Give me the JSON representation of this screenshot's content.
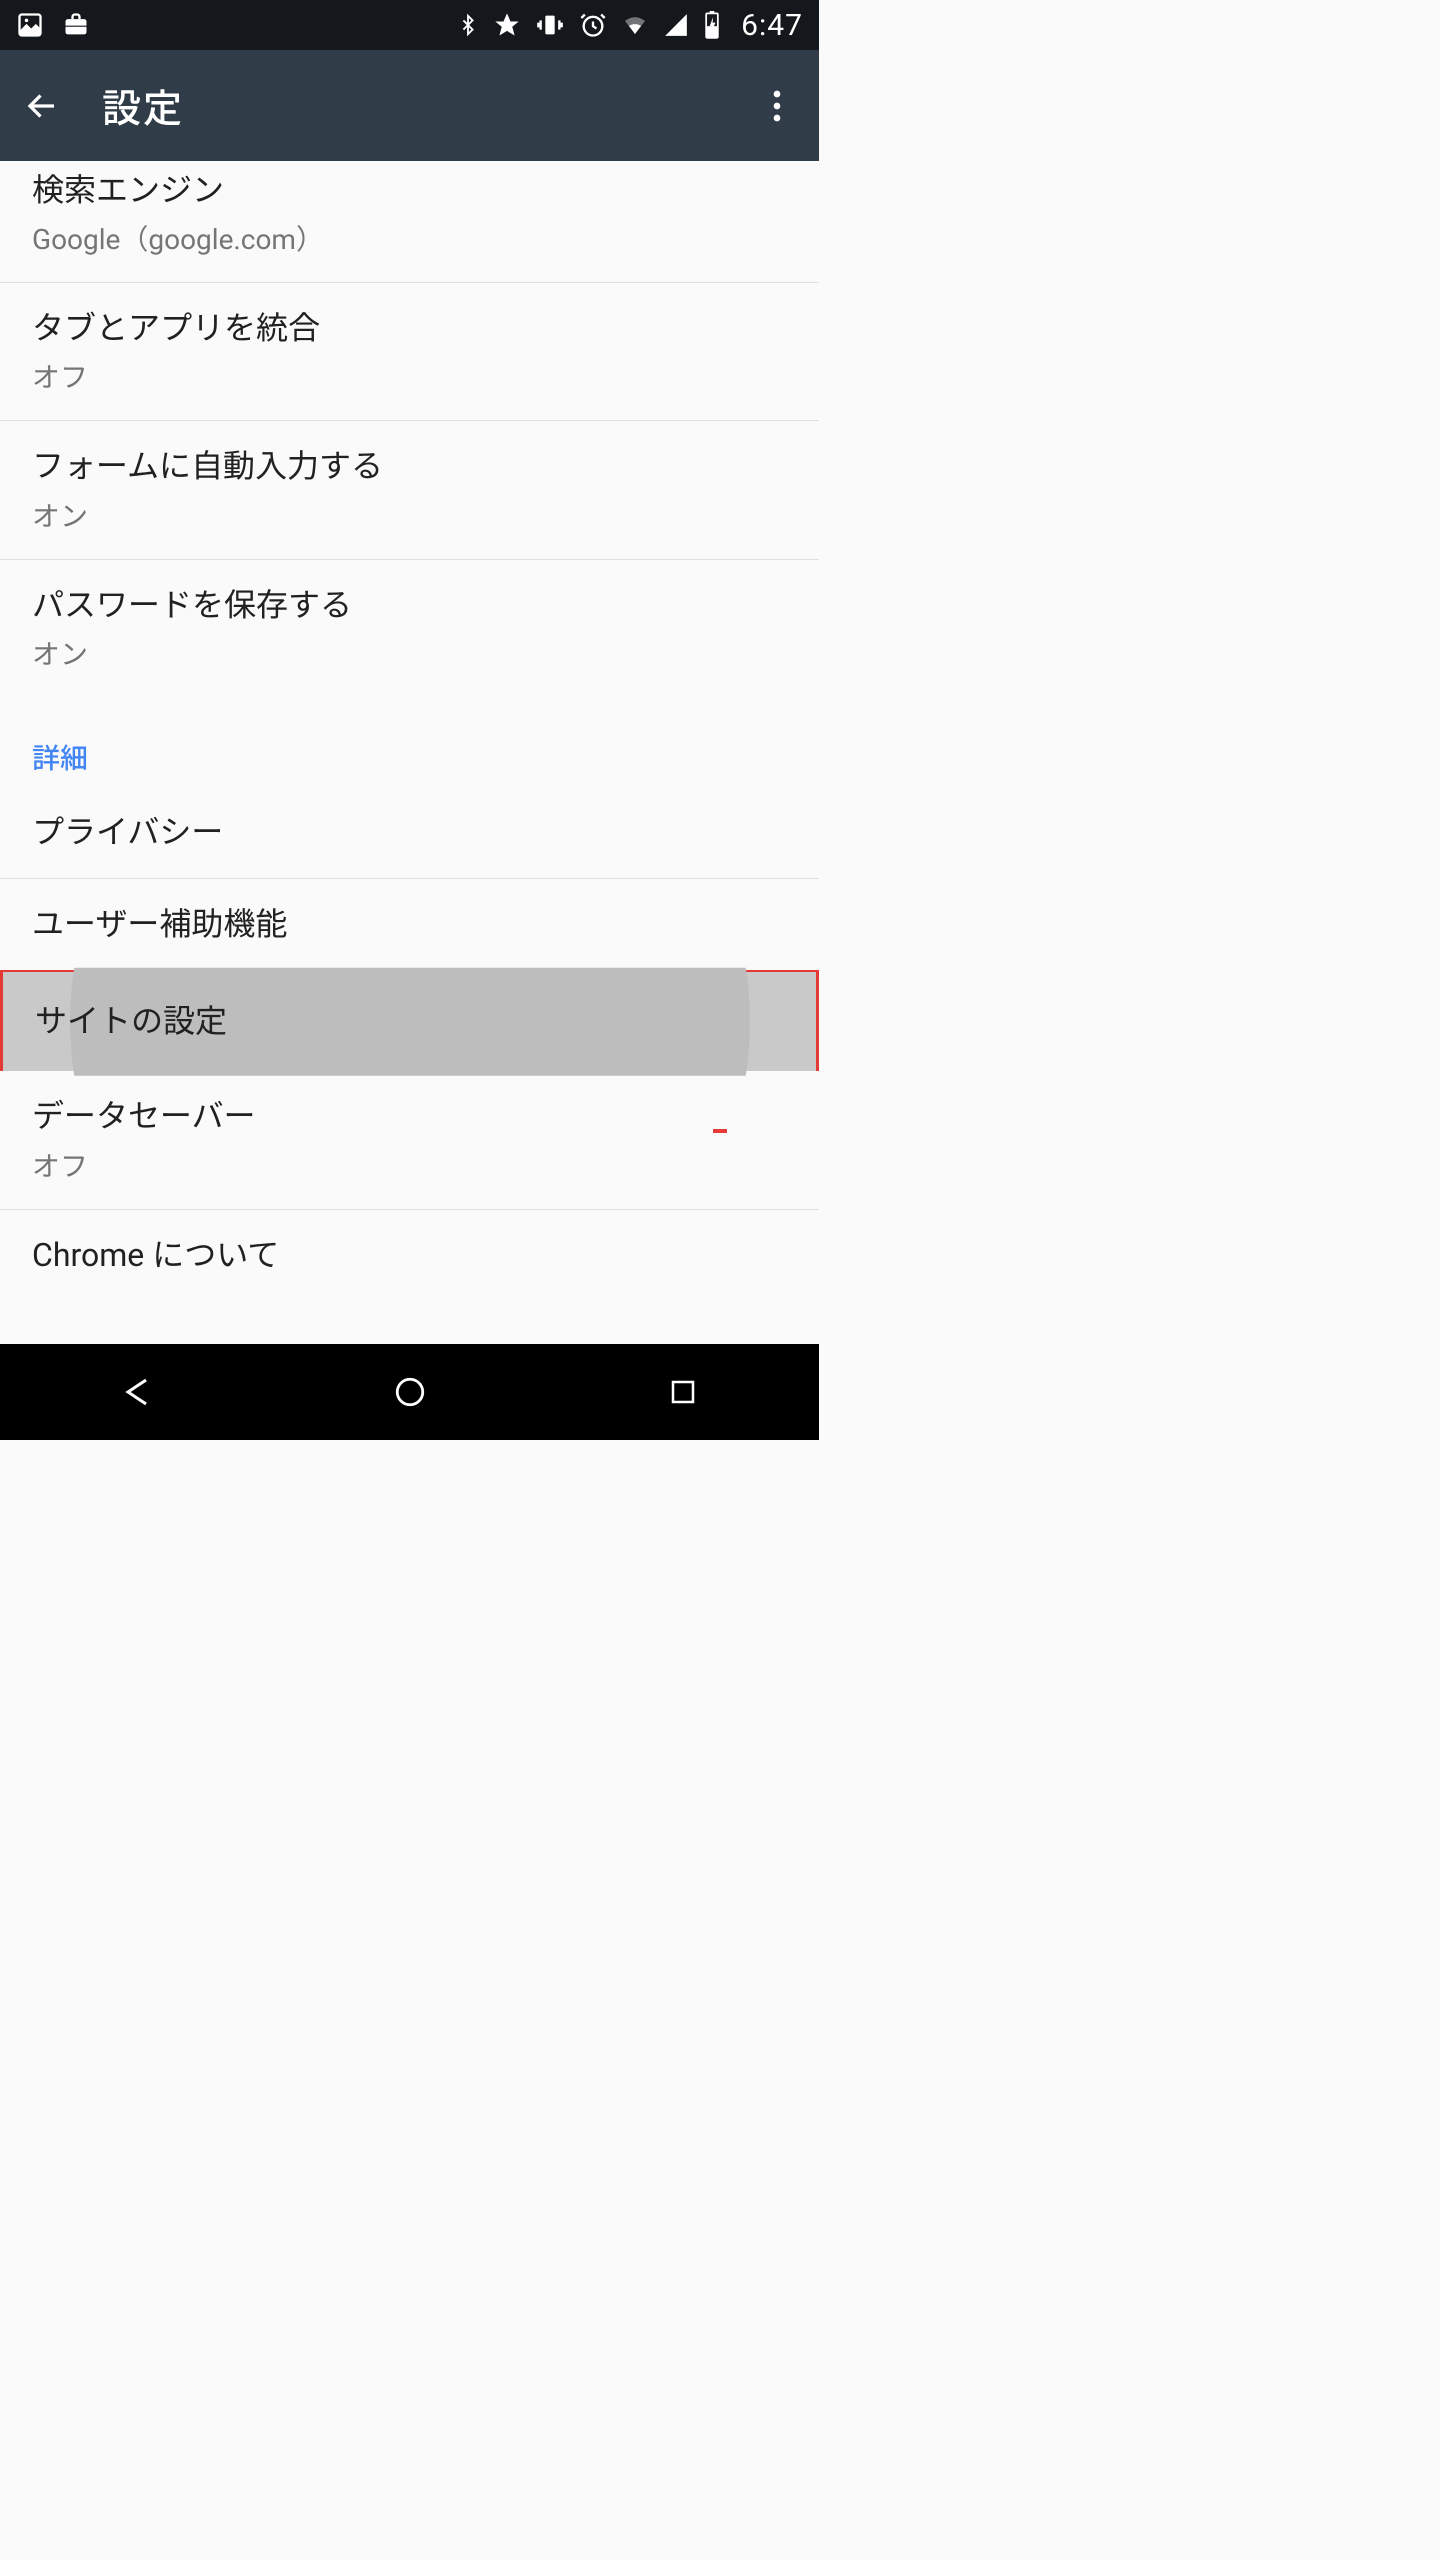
{
  "status": {
    "time": "6:47"
  },
  "appbar": {
    "title": "設定"
  },
  "sections": {
    "advanced_header": "詳細"
  },
  "rows": {
    "search_engine": {
      "title": "検索エンジン",
      "sub": "Google（google.com）"
    },
    "merge_tabs": {
      "title": "タブとアプリを統合",
      "sub": "オフ"
    },
    "autofill_forms": {
      "title": "フォームに自動入力する",
      "sub": "オン"
    },
    "save_passwords": {
      "title": "パスワードを保存する",
      "sub": "オン"
    },
    "privacy": {
      "title": "プライバシー"
    },
    "accessibility": {
      "title": "ユーザー補助機能"
    },
    "site_settings": {
      "title": "サイトの設定"
    },
    "data_saver": {
      "title": "データセーバー",
      "sub": "オフ"
    },
    "about_chrome": {
      "title": "Chrome について"
    }
  }
}
